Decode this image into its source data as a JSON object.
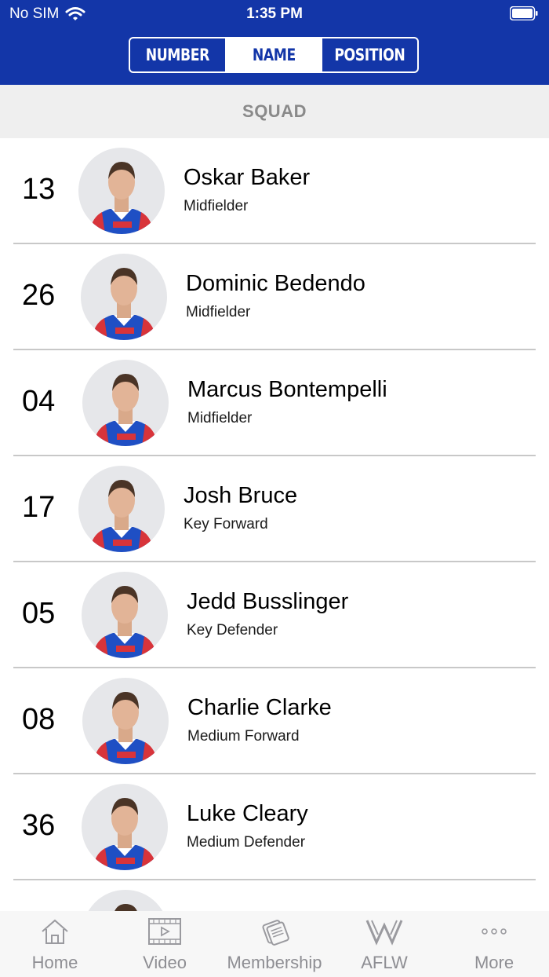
{
  "status_bar": {
    "carrier": "No SIM",
    "time": "1:35 PM"
  },
  "sort_control": {
    "options": [
      "NUMBER",
      "NAME",
      "POSITION"
    ],
    "selected": "NAME"
  },
  "section": {
    "title": "SQUAD"
  },
  "players": [
    {
      "number": "13",
      "name": "Oskar Baker",
      "position": "Midfielder"
    },
    {
      "number": "26",
      "name": "Dominic Bedendo",
      "position": "Midfielder"
    },
    {
      "number": "04",
      "name": "Marcus Bontempelli",
      "position": "Midfielder"
    },
    {
      "number": "17",
      "name": "Josh Bruce",
      "position": "Key Forward"
    },
    {
      "number": "05",
      "name": "Jedd Busslinger",
      "position": "Key Defender"
    },
    {
      "number": "08",
      "name": "Charlie Clarke",
      "position": "Medium Forward"
    },
    {
      "number": "36",
      "name": "Luke Cleary",
      "position": "Medium Defender"
    }
  ],
  "tab_bar": {
    "items": [
      {
        "label": "Home",
        "icon": "home-icon"
      },
      {
        "label": "Video",
        "icon": "video-icon"
      },
      {
        "label": "Membership",
        "icon": "membership-icon"
      },
      {
        "label": "AFLW",
        "icon": "aflw-icon"
      },
      {
        "label": "More",
        "icon": "more-icon"
      }
    ]
  },
  "colors": {
    "brand_blue": "#1336a8",
    "jersey_red": "#d8343a",
    "jersey_blue": "#1f4fc4"
  }
}
